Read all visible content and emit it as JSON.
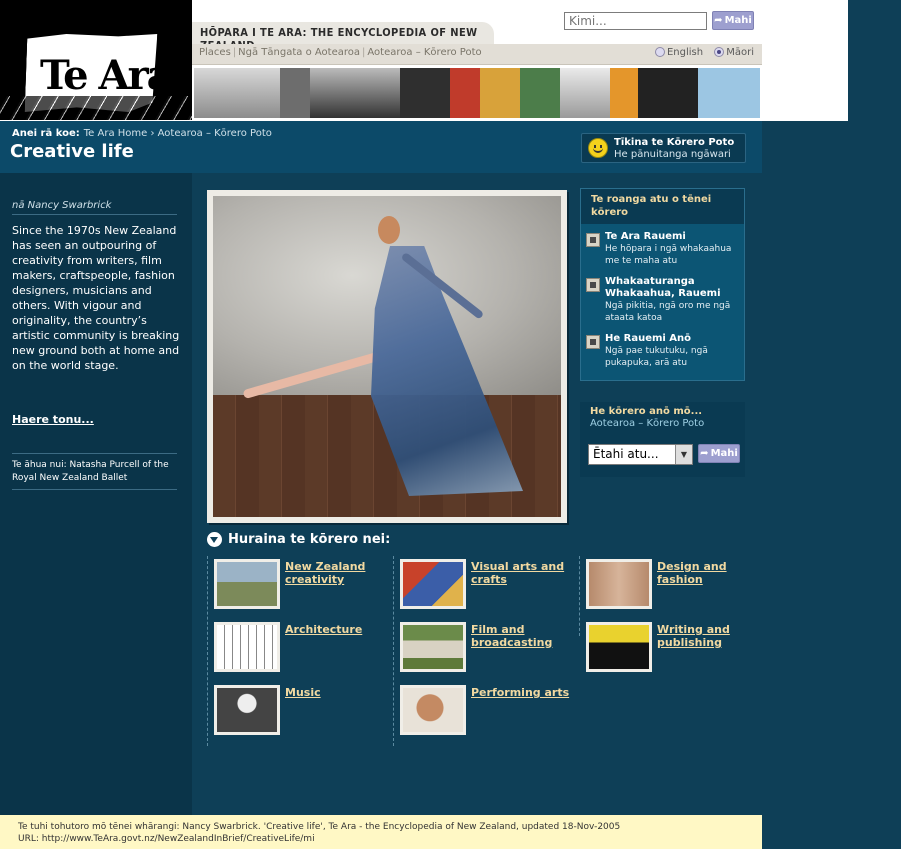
{
  "header": {
    "site_title": "HŌPARA I TE ARA: THE ENCYCLOPEDIA OF NEW ZEALAND",
    "nav_links": [
      "Places",
      "Ngā Tāngata o Aotearoa",
      "Aotearoa – Kōrero Poto"
    ],
    "search_placeholder": "Kimi...",
    "search_button": "Mahi",
    "lang_english": "English",
    "lang_maori": "Māori",
    "selected_language": "Māori"
  },
  "subheader": {
    "breadcrumb_label": "Anei rā koe:",
    "breadcrumb": "Te Ara Home › Aotearoa – Kōrero Poto",
    "page_title": "Creative life",
    "easy_read_title": "Tīkina te Kōrero Poto",
    "easy_read_sub": "He pānuitanga ngāwari"
  },
  "left": {
    "author": "nā Nancy Swarbrick",
    "intro": "Since the 1970s New Zealand has seen an outpouring of creativity from writers, film makers, craftspeople, fashion designers, musicians and others. With vigour and originality, the country’s artistic community is breaking new ground both at home and on the world stage.",
    "read_more": "Haere tonu...",
    "caption": "Te āhua nui: Natasha Purcell of the Royal New Zealand Ballet"
  },
  "resources": {
    "header": "Te roanga atu o tēnei kōrero",
    "items": [
      {
        "title": "Te Ara Rauemi",
        "desc": "He hōpara i ngā whakaahua me te maha atu"
      },
      {
        "title": "Whakaaturanga Whakaahua, Rauemi",
        "desc": "Ngā pikitia, ngā oro me ngā ataata katoa"
      },
      {
        "title": "He Rauemi Anō",
        "desc": "Ngā pae tukutuku, ngā pukapuka, arā atu"
      }
    ]
  },
  "more": {
    "header": "He kōrero anō mō...",
    "sub": "Aotearoa – Kōrero Poto",
    "select_value": "Ētahi atu...",
    "button": "Mahi"
  },
  "explore": {
    "heading": "Huraina te kōrero nei:",
    "topics": [
      {
        "label": "New Zealand creativity",
        "thumb": "landscape-art"
      },
      {
        "label": "Visual arts and crafts",
        "thumb": "painting"
      },
      {
        "label": "Design and fashion",
        "thumb": "necklace"
      },
      {
        "label": "Architecture",
        "thumb": "house-sketch"
      },
      {
        "label": "Film and broadcasting",
        "thumb": "sheep"
      },
      {
        "label": "Writing and publishing",
        "thumb": "book-cover"
      },
      {
        "label": "Music",
        "thumb": "musician"
      },
      {
        "label": "Performing arts",
        "thumb": "performer-face"
      }
    ]
  },
  "footer": {
    "citation": "Te tuhi tohutoro mō tēnei whārangi: Nancy Swarbrick. 'Creative life', Te Ara - the Encyclopedia of New Zealand, updated 18-Nov-2005",
    "url": "URL: http://www.TeAra.govt.nz/NewZealandInBrief/CreativeLife/mi"
  },
  "colors": {
    "page_bg": "#0e3f57",
    "link_gold": "#f1d9a1",
    "footer_bg": "#fff8c5"
  }
}
